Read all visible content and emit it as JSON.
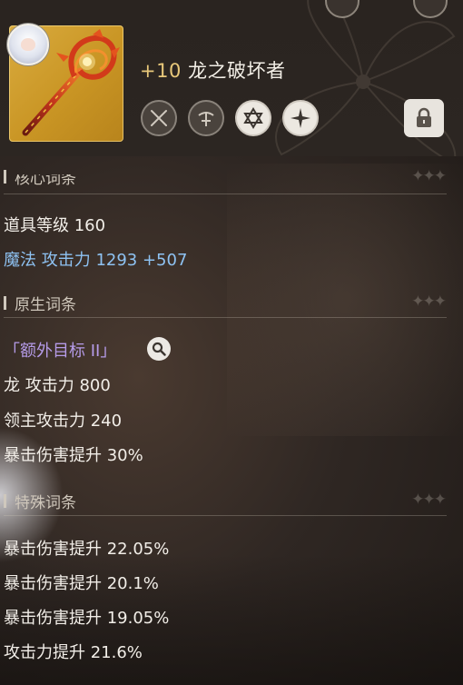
{
  "item": {
    "level_prefix": "+10",
    "name": "龙之破坏者",
    "frame_color": "#d2a232",
    "icons": [
      "dual-swords-icon",
      "crossbow-icon",
      "hexagram-icon",
      "cross-star-icon"
    ],
    "lock_icon": "lock-icon"
  },
  "sections": {
    "core": {
      "title": "核心词条"
    },
    "native": {
      "title": "原生词条"
    },
    "special": {
      "title": "特殊词条"
    },
    "stars": "✦✦✦"
  },
  "stats": {
    "item_level": "道具等级 160",
    "magic_attack": "魔法 攻击力 1293 +507",
    "extra_target": "「额外目标 II」",
    "dragon_attack": "龙 攻击力 800",
    "boss_attack": "领主攻击力 240",
    "crit_damage_native": "暴击伤害提升 30%",
    "special_1": "暴击伤害提升 22.05%",
    "special_2": "暴击伤害提升 20.1%",
    "special_3": "暴击伤害提升 19.05%",
    "special_4": "攻击力提升 21.6%"
  },
  "colors": {
    "magic_attack": "#8ec2f2",
    "extra_target": "#b59be8",
    "level_prefix": "#e8c87a"
  }
}
